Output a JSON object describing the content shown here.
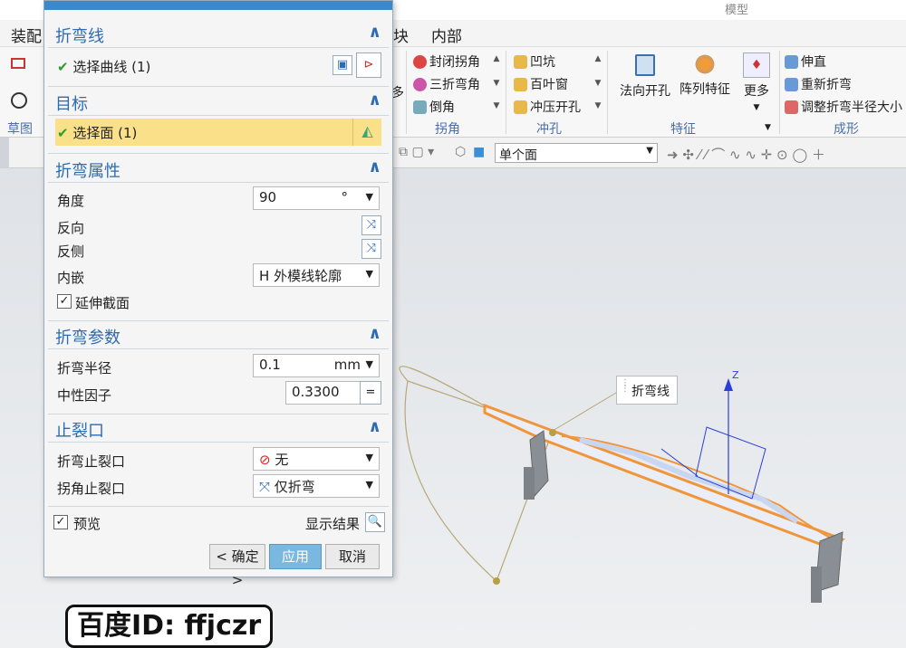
{
  "window": {
    "title_fragment": "模型"
  },
  "menu": [
    "装配",
    "块",
    "内部"
  ],
  "ribbon": {
    "left_group_label": "草图",
    "corner_items": [
      "封闭拐角",
      "三折弯角",
      "倒角"
    ],
    "corner_label": "拐角",
    "more_stub": "多",
    "punch_items": [
      "凹坑",
      "百叶窗",
      "冲压开孔"
    ],
    "punch_label": "冲孔",
    "feature_items": [
      "法向开孔",
      "阵列特征",
      "更多"
    ],
    "feature_label": "特征",
    "form_items": [
      "伸直",
      "重新折弯",
      "调整折弯半径大小"
    ],
    "form_label": "成形"
  },
  "selection_bar": {
    "filter_value": "单个面"
  },
  "dialog": {
    "sections": {
      "bend_line": {
        "title": "折弯线",
        "row_label": "选择曲线 (1)"
      },
      "target": {
        "title": "目标",
        "row_label": "选择面 (1)"
      },
      "bend_props": {
        "title": "折弯属性",
        "angle_label": "角度",
        "angle_value": "90",
        "angle_unit": "°",
        "reverse_label": "反向",
        "reverse_side_label": "反侧",
        "inset_label": "内嵌",
        "inset_value": "外模线轮廓",
        "inset_prefix": "H",
        "extend_label": "延伸截面"
      },
      "bend_params": {
        "title": "折弯参数",
        "radius_label": "折弯半径",
        "radius_value": "0.1",
        "radius_unit": "mm",
        "kfactor_label": "中性因子",
        "kfactor_value": "0.3300",
        "kfactor_op": "="
      },
      "relief": {
        "title": "止裂口",
        "bend_relief_label": "折弯止裂口",
        "bend_relief_value": "无",
        "corner_relief_label": "拐角止裂口",
        "corner_relief_value": "仅折弯"
      }
    },
    "preview_label": "预览",
    "show_result_label": "显示结果",
    "ok_label": "< 确定 >",
    "apply_label": "应用",
    "cancel_label": "取消"
  },
  "viewport": {
    "tooltip": "折弯线",
    "axis_label": "Z"
  },
  "watermark": "百度ID: ffjczr"
}
